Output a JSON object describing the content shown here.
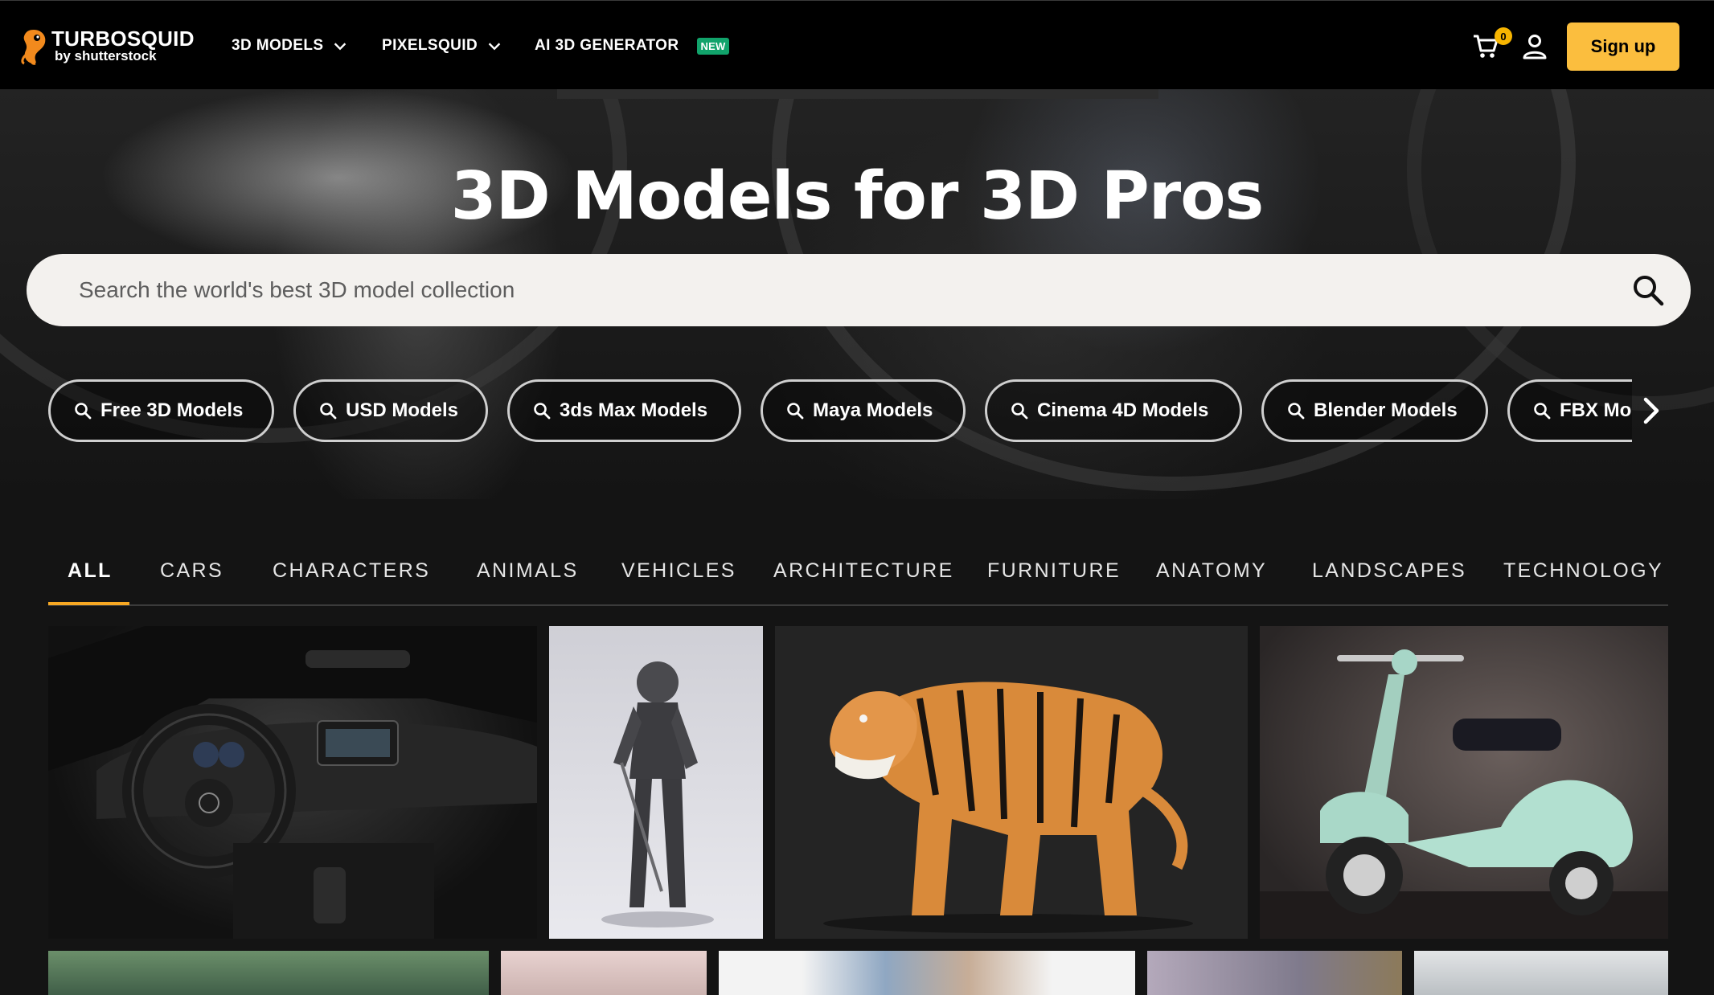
{
  "nav": {
    "logo_title": "TURBOSQUID",
    "logo_sub": "by shutterstock",
    "menu": [
      {
        "label": "3D MODELS",
        "has_dropdown": true
      },
      {
        "label": "PIXELSQUID",
        "has_dropdown": true
      },
      {
        "label": "AI 3D GENERATOR",
        "badge": "NEW"
      }
    ],
    "cart_count": "0",
    "signup_label": "Sign up"
  },
  "hero": {
    "title": "3D Models for 3D Pros",
    "search_placeholder": "Search the world's best 3D model collection",
    "chips": [
      "Free 3D Models",
      "USD Models",
      "3ds Max Models",
      "Maya Models",
      "Cinema 4D Models",
      "Blender Models",
      "FBX Mo"
    ]
  },
  "categories": {
    "active": "ALL",
    "tabs": [
      "ALL",
      "CARS",
      "CHARACTERS",
      "ANIMALS",
      "VEHICLES",
      "ARCHITECTURE",
      "FURNITURE",
      "ANATOMY",
      "LANDSCAPES",
      "TECHNOLOGY"
    ]
  },
  "colors": {
    "accent": "#fbbe3e",
    "tab_underline": "#f7a823",
    "badge_new": "#11a36b",
    "nav_bg": "#000000",
    "page_bg": "#141414"
  },
  "icons": [
    "turbosquid-logo-icon",
    "chevron-down-icon",
    "cart-icon",
    "user-icon",
    "search-icon",
    "chevron-right-icon"
  ]
}
